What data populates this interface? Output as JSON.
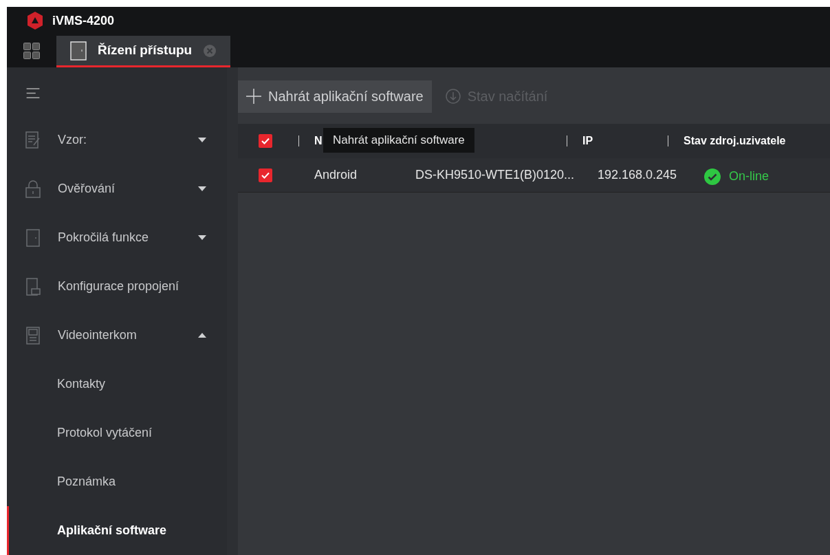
{
  "window": {
    "title": "iVMS-4200"
  },
  "tabs": [
    {
      "label": "Řízení přístupu",
      "selected": true
    }
  ],
  "sidebar": {
    "items": [
      {
        "label": "Vzor:",
        "kind": "form",
        "expanded": false,
        "selected": false
      },
      {
        "label": "Ověřování",
        "kind": "lock",
        "expanded": false,
        "selected": false
      },
      {
        "label": "Pokročilá funkce",
        "kind": "door",
        "expanded": false,
        "selected": false
      },
      {
        "label": "Konfigurace propojení",
        "kind": "link",
        "selected": false
      },
      {
        "label": "Videointerkom",
        "kind": "intercom",
        "expanded": true,
        "selected": false,
        "children": [
          {
            "label": "Kontakty",
            "selected": false
          },
          {
            "label": "Protokol vytáčení",
            "selected": false
          },
          {
            "label": "Poznámka",
            "selected": false
          },
          {
            "label": "Aplikační software",
            "selected": true
          }
        ]
      }
    ]
  },
  "toolbar": [
    {
      "label": "Nahrát aplikační software",
      "kind": "add",
      "disabled": false
    },
    {
      "label": "Stav načítání",
      "kind": "download",
      "disabled": true
    }
  ],
  "table": {
    "header_checked": true,
    "columns": [
      "N",
      "",
      "IP",
      "Stav zdroj.uzivatele"
    ],
    "rows": [
      {
        "checked": true,
        "cells": [
          "Android",
          "DS-KH9510-WTE1(B)0120...",
          "192.168.0.245"
        ],
        "status": "On-line",
        "online": true
      }
    ]
  },
  "tooltip": "Nahrát aplikační software"
}
